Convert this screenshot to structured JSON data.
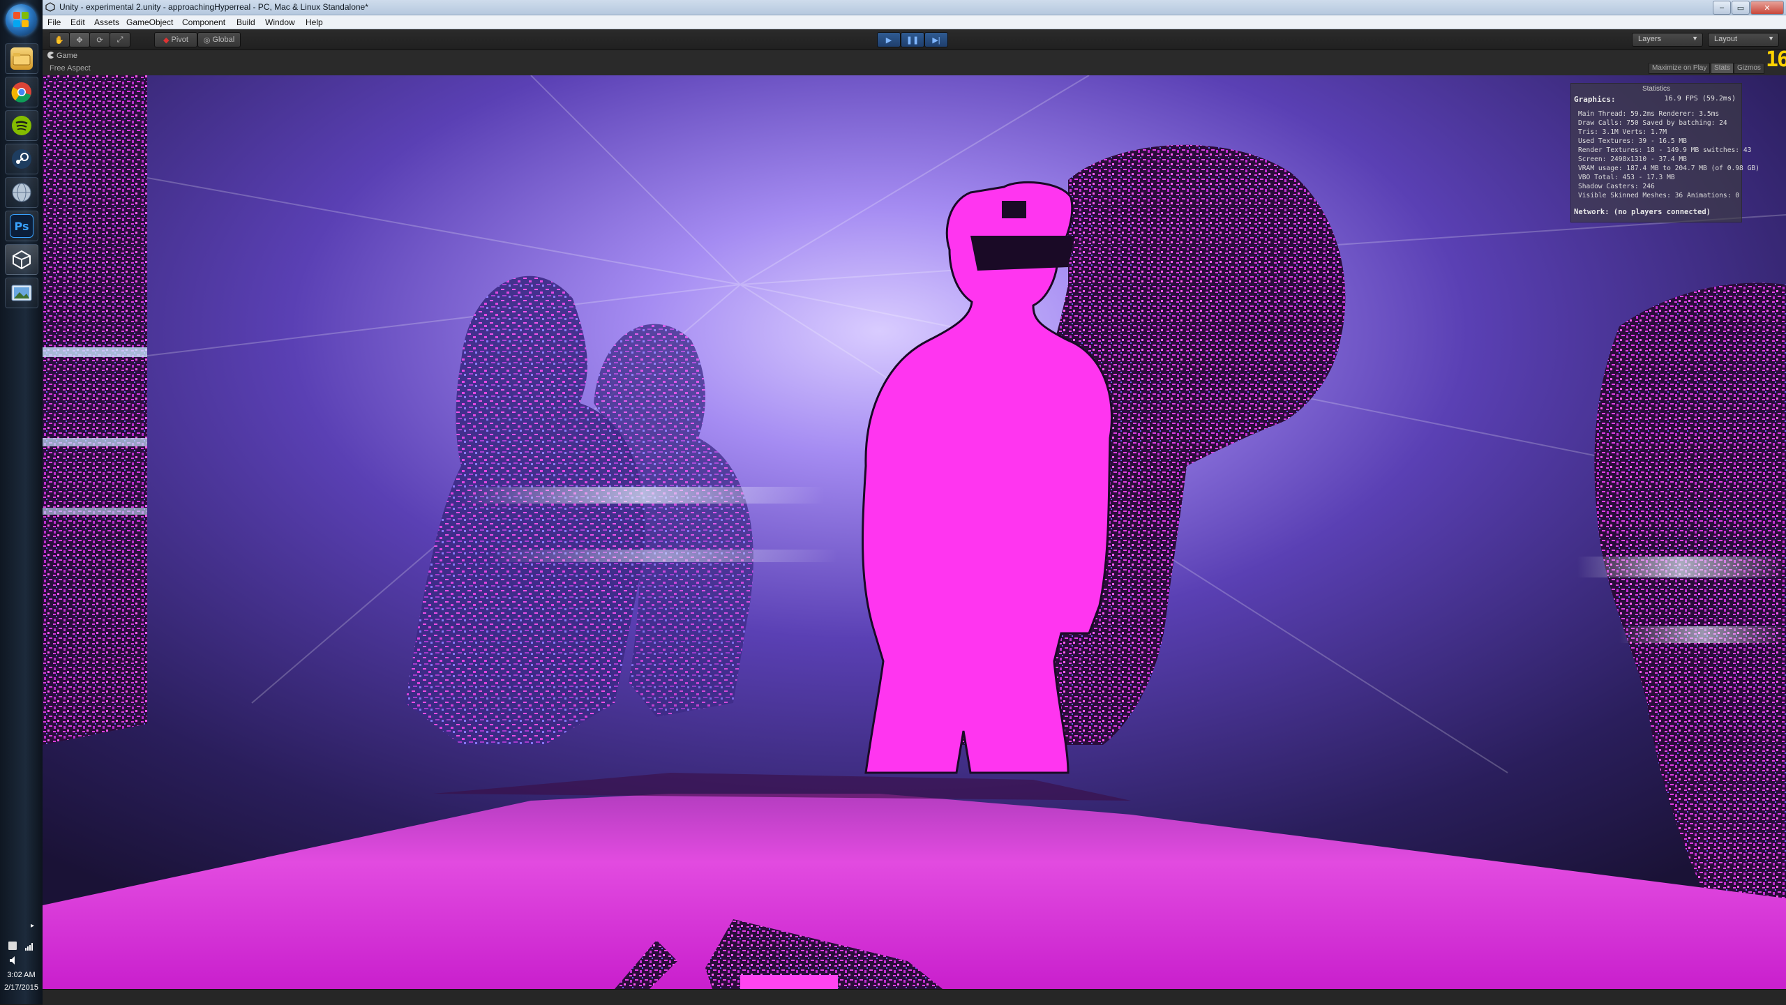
{
  "taskbar": {
    "apps": [
      {
        "name": "windows-explorer",
        "icon": "folder-icon",
        "color": "#e8b84a"
      },
      {
        "name": "chrome",
        "icon": "chrome-icon",
        "color": "#dd4b39"
      },
      {
        "name": "spotify",
        "icon": "spotify-icon",
        "color": "#1db954"
      },
      {
        "name": "steam",
        "icon": "steam-icon",
        "color": "#1b2838"
      },
      {
        "name": "unknown-app",
        "icon": "globe-icon",
        "color": "#8fa2b8"
      },
      {
        "name": "photoshop",
        "icon": "photoshop-icon",
        "color": "#0b1e3a",
        "glyph": "Ps"
      },
      {
        "name": "unity",
        "icon": "unity-icon",
        "color": "#2a2a2a"
      },
      {
        "name": "photo-viewer",
        "icon": "photo-viewer-icon",
        "color": "#4d88c8"
      }
    ],
    "clock": {
      "time": "3:02 AM",
      "date": "2/17/2015"
    }
  },
  "window": {
    "title": "Unity - experimental 2.unity - approachingHyperreal - PC, Mac & Linux Standalone*"
  },
  "menu": [
    "File",
    "Edit",
    "Assets",
    "GameObject",
    "Component",
    "Build",
    "Window",
    "Help"
  ],
  "toolbar": {
    "pivot": "Pivot",
    "global": "Global",
    "layers": "Layers",
    "layout": "Layout"
  },
  "game_view": {
    "tab": "Game",
    "aspect": "Free Aspect",
    "maximize": "Maximize on Play",
    "stats": "Stats",
    "gizmos": "Gizmos",
    "fps_counter": "16"
  },
  "statistics": {
    "title": "Statistics",
    "graphics_label": "Graphics:",
    "fps": "16.9 FPS (59.2ms)",
    "lines": [
      "Main Thread: 59.2ms  Renderer: 3.5ms",
      "Draw Calls: 750    Saved by batching: 24",
      "Tris: 3.1M    Verts: 1.7M",
      "Used Textures: 39 - 16.5 MB",
      "Render Textures: 18 - 149.9 MB    switches: 43",
      "Screen: 2498x1310 - 37.4 MB",
      "VRAM usage: 187.4 MB to 204.7 MB (of 0.98 GB)",
      "VBO Total: 453 - 17.3 MB",
      "Shadow Casters: 246",
      "Visible Skinned Meshes: 36    Animations: 0"
    ],
    "network": "Network: (no players connected)"
  }
}
